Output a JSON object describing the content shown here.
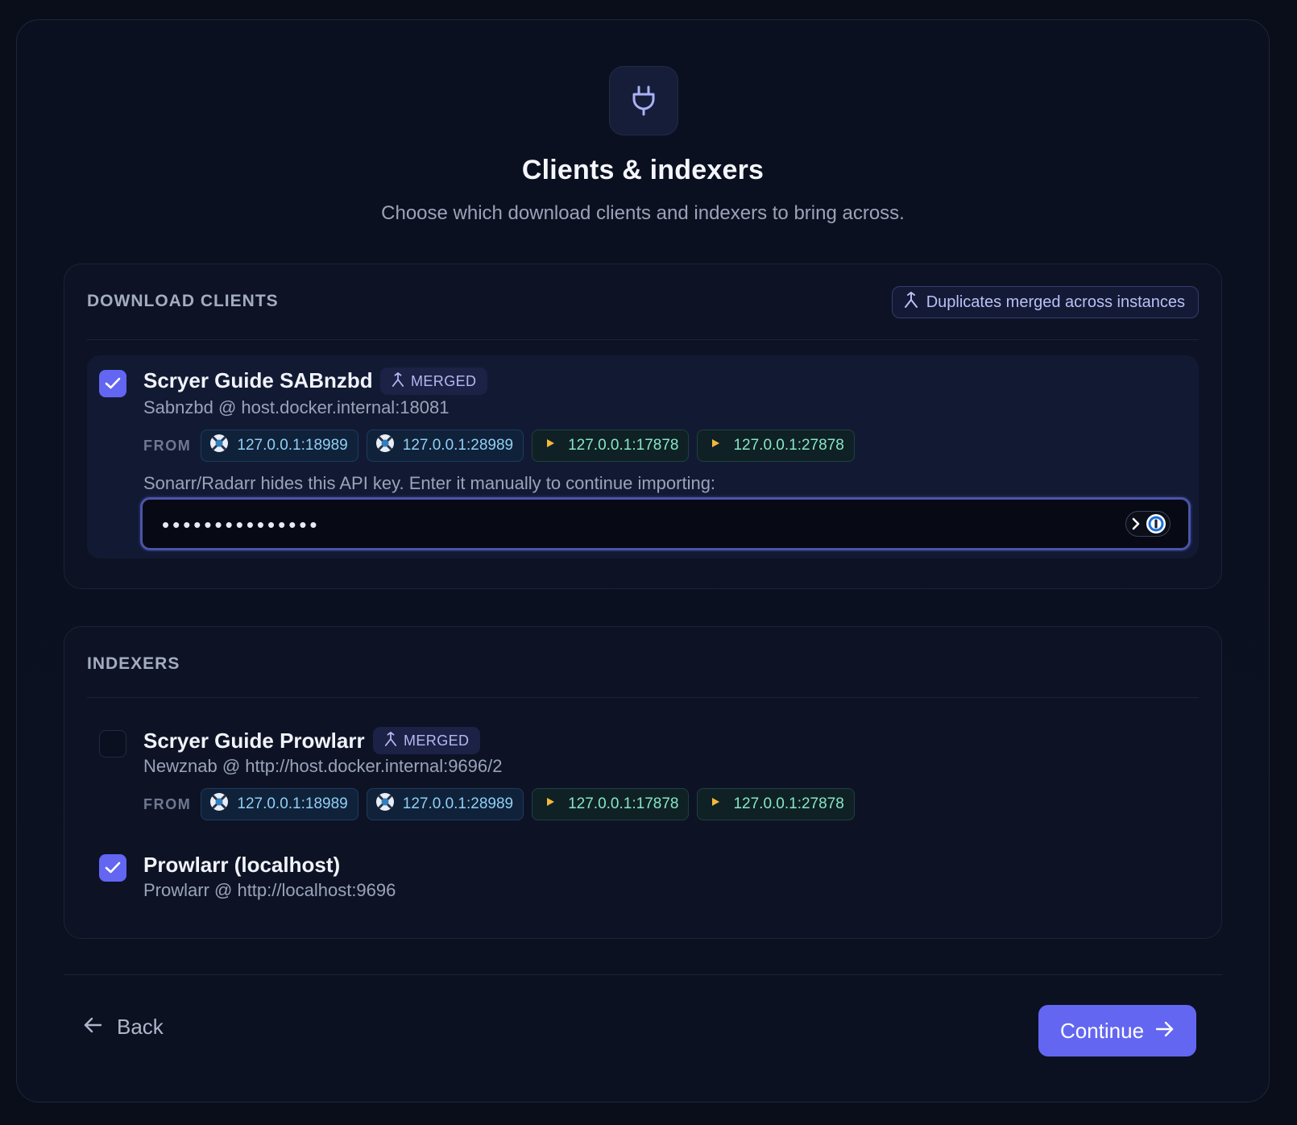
{
  "header": {
    "title": "Clients & indexers",
    "subtitle": "Choose which download clients and indexers to bring across.",
    "icon": "plug-icon"
  },
  "download_clients": {
    "section_title": "DOWNLOAD CLIENTS",
    "duplicates_badge": "Duplicates merged across instances",
    "items": [
      {
        "name": "Scryer Guide SABnzbd",
        "checked": true,
        "merged_label": "MERGED",
        "subtitle": "Sabnzbd @ host.docker.internal:18081",
        "from_label": "FROM",
        "sources": [
          "127.0.0.1:18989",
          "127.0.0.1:28989",
          "127.0.0.1:17878",
          "127.0.0.1:27878"
        ],
        "api_note": "Sonarr/Radarr hides this API key. Enter it manually to continue importing:",
        "api_key_masked": "•••••••••••••••"
      }
    ]
  },
  "indexers": {
    "section_title": "INDEXERS",
    "items": [
      {
        "name": "Scryer Guide Prowlarr",
        "checked": false,
        "merged_label": "MERGED",
        "subtitle": "Newznab @ http://host.docker.internal:9696/2",
        "from_label": "FROM",
        "sources": [
          "127.0.0.1:18989",
          "127.0.0.1:28989",
          "127.0.0.1:17878",
          "127.0.0.1:27878"
        ]
      },
      {
        "name": "Prowlarr (localhost)",
        "checked": true,
        "subtitle": "Prowlarr @ http://localhost:9696"
      }
    ]
  },
  "footer": {
    "back_label": "Back",
    "continue_label": "Continue"
  },
  "colors": {
    "accent": "#6366f1",
    "background": "#0a0e1b",
    "chip_blue_text": "#8fd0f5",
    "chip_green_text": "#86e6c6",
    "play_icon": "#f5b73b"
  }
}
